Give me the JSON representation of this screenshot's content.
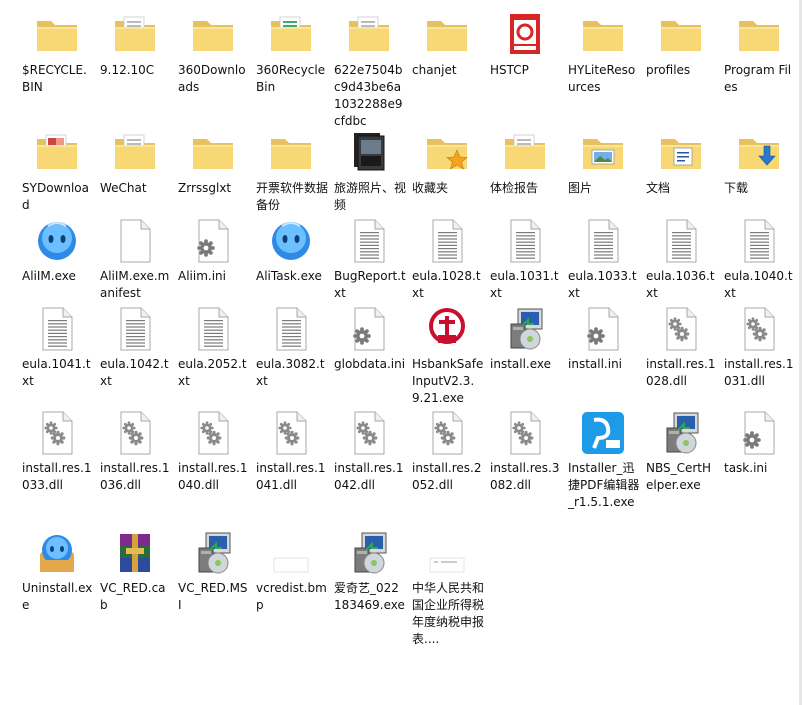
{
  "desktop": {
    "items": [
      {
        "label": "$RECYCLE.BIN",
        "icon": "folder-icon"
      },
      {
        "label": "9.12.10C",
        "icon": "folder-with-doc-icon"
      },
      {
        "label": "360Downloads",
        "icon": "folder-icon"
      },
      {
        "label": "360RecycleBin",
        "icon": "folder-green-doc-icon"
      },
      {
        "label": "622e7504bc9d43be6a1032288e9cfdbc",
        "icon": "folder-with-doc-icon"
      },
      {
        "label": "chanjet",
        "icon": "folder-icon"
      },
      {
        "label": "HSTCP",
        "icon": "hstcp-app-icon"
      },
      {
        "label": "HYLiteResources",
        "icon": "folder-icon"
      },
      {
        "label": "profiles",
        "icon": "folder-icon"
      },
      {
        "label": "Program Files",
        "icon": "folder-icon"
      },
      {
        "label": "SYDownload",
        "icon": "folder-colorful-icon"
      },
      {
        "label": "WeChat",
        "icon": "folder-with-doc-icon"
      },
      {
        "label": "Zrrssglxt",
        "icon": "folder-icon"
      },
      {
        "label": "开票软件数据备份",
        "icon": "folder-icon"
      },
      {
        "label": "旅游照片、视频",
        "icon": "folder-dark-photos-icon"
      },
      {
        "label": "收藏夹",
        "icon": "favorites-folder-icon"
      },
      {
        "label": "体检报告",
        "icon": "folder-with-doc-icon"
      },
      {
        "label": "图片",
        "icon": "pictures-folder-icon"
      },
      {
        "label": "文档",
        "icon": "documents-folder-icon"
      },
      {
        "label": "下载",
        "icon": "downloads-folder-icon"
      },
      {
        "label": "AliIM.exe",
        "icon": "aliim-app-icon"
      },
      {
        "label": "AliIM.exe.manifest",
        "icon": "blank-file-icon"
      },
      {
        "label": "Aliim.ini",
        "icon": "settings-file-icon"
      },
      {
        "label": "AliTask.exe",
        "icon": "aliim-app-icon"
      },
      {
        "label": "BugReport.txt",
        "icon": "text-file-icon"
      },
      {
        "label": "eula.1028.txt",
        "icon": "text-file-icon"
      },
      {
        "label": "eula.1031.txt",
        "icon": "text-file-icon"
      },
      {
        "label": "eula.1033.txt",
        "icon": "text-file-icon"
      },
      {
        "label": "eula.1036.txt",
        "icon": "text-file-icon"
      },
      {
        "label": "eula.1040.txt",
        "icon": "text-file-icon"
      },
      {
        "label": "eula.1041.txt",
        "icon": "text-file-icon"
      },
      {
        "label": "eula.1042.txt",
        "icon": "text-file-icon"
      },
      {
        "label": "eula.2052.txt",
        "icon": "text-file-icon"
      },
      {
        "label": "eula.3082.txt",
        "icon": "text-file-icon"
      },
      {
        "label": "globdata.ini",
        "icon": "settings-file-icon"
      },
      {
        "label": "HsbankSafeInputV2.3.9.21.exe",
        "icon": "hsbank-app-icon"
      },
      {
        "label": "install.exe",
        "icon": "installer-icon"
      },
      {
        "label": "install.ini",
        "icon": "settings-file-icon"
      },
      {
        "label": "install.res.1028.dll",
        "icon": "dll-file-icon"
      },
      {
        "label": "install.res.1031.dll",
        "icon": "dll-file-icon"
      },
      {
        "label": "install.res.1033.dll",
        "icon": "dll-file-icon"
      },
      {
        "label": "install.res.1036.dll",
        "icon": "dll-file-icon"
      },
      {
        "label": "install.res.1040.dll",
        "icon": "dll-file-icon"
      },
      {
        "label": "install.res.1041.dll",
        "icon": "dll-file-icon"
      },
      {
        "label": "install.res.1042.dll",
        "icon": "dll-file-icon"
      },
      {
        "label": "install.res.2052.dll",
        "icon": "dll-file-icon"
      },
      {
        "label": "install.res.3082.dll",
        "icon": "dll-file-icon"
      },
      {
        "label": "Installer_迅捷PDF编辑器_r1.5.1.exe",
        "icon": "pdf-app-icon"
      },
      {
        "label": "NBS_CertHelper.exe",
        "icon": "installer-icon"
      },
      {
        "label": "task.ini",
        "icon": "settings-file-icon"
      },
      {
        "label": "Uninstall.exe",
        "icon": "uninstall-app-icon"
      },
      {
        "label": "VC_RED.cab",
        "icon": "winrar-archive-icon"
      },
      {
        "label": "VC_RED.MSI",
        "icon": "installer-icon"
      },
      {
        "label": "vcredist.bmp",
        "icon": "bmp-file-icon"
      },
      {
        "label": "爱奇艺_022183469.exe",
        "icon": "installer-icon"
      },
      {
        "label": "中华人民共和国企业所得税年度纳税申报表....",
        "icon": "doc-thumb-icon"
      }
    ]
  }
}
